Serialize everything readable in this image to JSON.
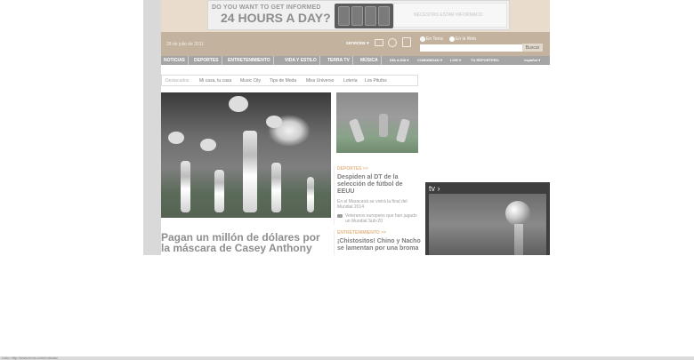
{
  "banner": {
    "ad_line1": "DO YOU WANT TO GET INFORMED",
    "ad_line2": "24 HOURS A DAY?",
    "ad_right_text": "NECESITAS ESTAR INFORMADO"
  },
  "header": {
    "date": "28 de julio de 2011",
    "servicios": "servicios ▾",
    "search_option_terra": "En Terra",
    "search_option_web": "En la Web",
    "search_placeholder": "",
    "search_button": "Buscar"
  },
  "nav": {
    "items": [
      "NOTICIAS",
      "DEPORTES",
      "ENTRETENIMIENTO",
      "VIDA Y ESTILO",
      "TERRA TV",
      "MÚSICA"
    ],
    "right_items": [
      "DÍA A DÍA ▾",
      "COMUNIDAD ▾",
      "LIVE ▾",
      "TU REPORTERO"
    ],
    "español": "español ▾"
  },
  "subnav": {
    "items": [
      "Destacados",
      "Mi casa, tu casa",
      "Music City",
      "Tips de Moda",
      "Miss Universo",
      "Lotería",
      "Los Pitufos"
    ]
  },
  "main": {
    "headline": "Pagan un millón de dólares por la máscara de Casey Anthony"
  },
  "middle": {
    "block1": {
      "category": "DEPORTES >>",
      "title": "Despiden al DT de la selección de fútbol de EEUU",
      "sub1": "En el Maracaná se vivirá la final del Mundial 2014",
      "sub2": "Veteranos europeos que han jugado un Mundial Sub-20"
    },
    "block2": {
      "category": "ENTRETENIMIENTO >>",
      "title": "¡Chistositos! Chino y Nacho se lamentan por una broma"
    }
  },
  "tv": {
    "label": "tv ›"
  },
  "status": {
    "text": "Listo: http://www.terra.com/noticias/"
  }
}
